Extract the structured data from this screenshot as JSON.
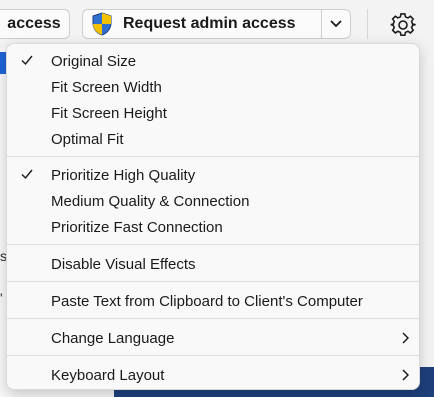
{
  "toolbar": {
    "access_label": "access",
    "admin_label": "Request admin access"
  },
  "background": {
    "frag_s": "s",
    "frag_quote": "'"
  },
  "menu": {
    "size_items": [
      {
        "label": "Original Size",
        "checked": true
      },
      {
        "label": "Fit Screen Width",
        "checked": false
      },
      {
        "label": "Fit Screen Height",
        "checked": false
      },
      {
        "label": "Optimal Fit",
        "checked": false
      }
    ],
    "quality_items": [
      {
        "label": "Prioritize High Quality",
        "checked": true
      },
      {
        "label": "Medium Quality & Connection",
        "checked": false
      },
      {
        "label": "Prioritize Fast Connection",
        "checked": false
      }
    ],
    "disable_effects": "Disable Visual Effects",
    "paste_text": "Paste Text from Clipboard to Client's Computer",
    "change_language": "Change Language",
    "keyboard_layout": "Keyboard Layout"
  },
  "icons": {
    "shield": "uac-shield-icon",
    "chevron": "chevron-down-icon",
    "settings": "gear-icon",
    "check": "checkmark-icon",
    "submenu": "chevron-right-icon"
  },
  "colors": {
    "accent_blue": "#1f63d6",
    "shield_yellow": "#f2c200",
    "shield_blue": "#2f6fd0"
  }
}
